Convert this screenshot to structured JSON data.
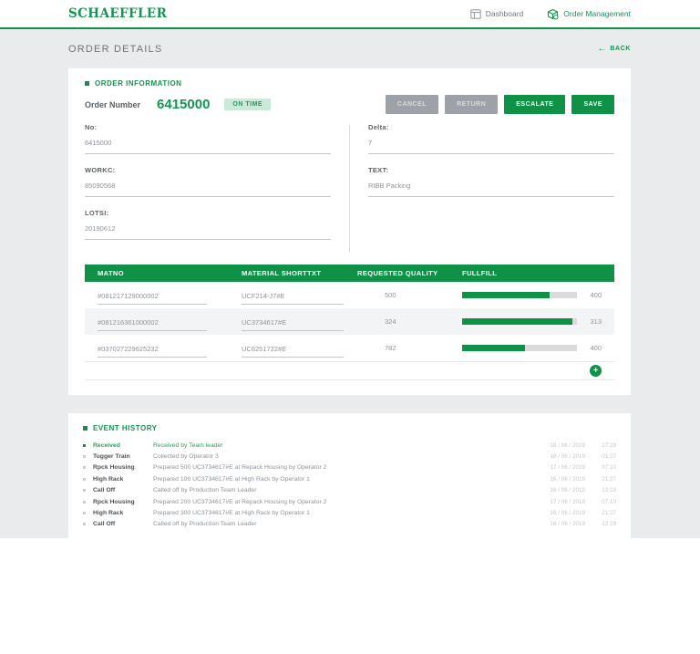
{
  "brand": {
    "logo": "SCHAEFFLER"
  },
  "nav": {
    "dashboard": "Dashboard",
    "order_management": "Order Management"
  },
  "page": {
    "title": "ORDER DETAILS",
    "back": "BACK",
    "back_arrow": "←"
  },
  "order_info": {
    "section_title": "ORDER INFORMATION",
    "order_number_label": "Order Number",
    "order_number": "6415000",
    "status": "ON TIME",
    "buttons": {
      "cancel": "CANCEL",
      "return": "RETURN",
      "escalate": "ESCALATE",
      "save": "SAVE"
    },
    "fields": {
      "no_label": "No:",
      "no": "6415000",
      "workc_label": "WORKC:",
      "workc": "85090568",
      "lotsi_label": "LOTSI:",
      "lotsi": "20190612",
      "delta_label": "Delta:",
      "delta": "7",
      "text_label": "TEXT:",
      "text": "RIBB Packing"
    }
  },
  "materials_table": {
    "headers": [
      "MATNO",
      "MATERIAL SHORTTXT",
      "REQUESTED QUALITY",
      "FULLFILL"
    ],
    "rows": [
      {
        "matno": "#081217129000002",
        "shorttxt": "UCF214-J7#E",
        "requested": "500",
        "fullfill": "400",
        "progress_pct": 76
      },
      {
        "matno": "#081216361000002",
        "shorttxt": "UC3734617#E",
        "requested": "324",
        "fullfill": "313",
        "progress_pct": 96
      },
      {
        "matno": "#037027229625232",
        "shorttxt": "UC6251722#E",
        "requested": "782",
        "fullfill": "400",
        "progress_pct": 55
      }
    ],
    "add_label": "+"
  },
  "event_history": {
    "section_title": "EVENT HISTORY",
    "events": [
      {
        "label": "Received",
        "description": "Received by Team leader",
        "date": "18 / 06 / 2019",
        "time": "17:29"
      },
      {
        "label": "Tugger Train",
        "description": "Collected by Operator 3",
        "date": "18 / 06 / 2019",
        "time": "01:27"
      },
      {
        "label": "Rpck Housing",
        "description": "Prepared 500 UC3734617#E at Repack Housing by Operator 2",
        "date": "17 / 06 / 2019",
        "time": "07:10"
      },
      {
        "label": "High Rack",
        "description": "Prepared 100 UC3734617#E at High Rack by Operator 1",
        "date": "16 / 06 / 2019",
        "time": "21:27"
      },
      {
        "label": "Call Off",
        "description": "Called off by Production Team Leader",
        "date": "16 / 06 / 2019",
        "time": "12:19"
      },
      {
        "label": "Rpck Housing",
        "description": "Prepared 200 UC3734617#E at Repack Housing by Operator 2",
        "date": "17 / 06 / 2019",
        "time": "07:10"
      },
      {
        "label": "High Rack",
        "description": "Prepared 300 UC3734617#E at High Rack by Operator 1",
        "date": "16 / 06 / 2019",
        "time": "21:27"
      },
      {
        "label": "Call Off",
        "description": "Called off by Production Team Leader",
        "date": "16 / 06 / 2019",
        "time": "12:19"
      }
    ]
  },
  "colors": {
    "brand_green": "#0f9148",
    "light_green_badge": "#cbe9d9",
    "gray_button": "#9ca2a7",
    "page_bg": "#e9ebec"
  }
}
